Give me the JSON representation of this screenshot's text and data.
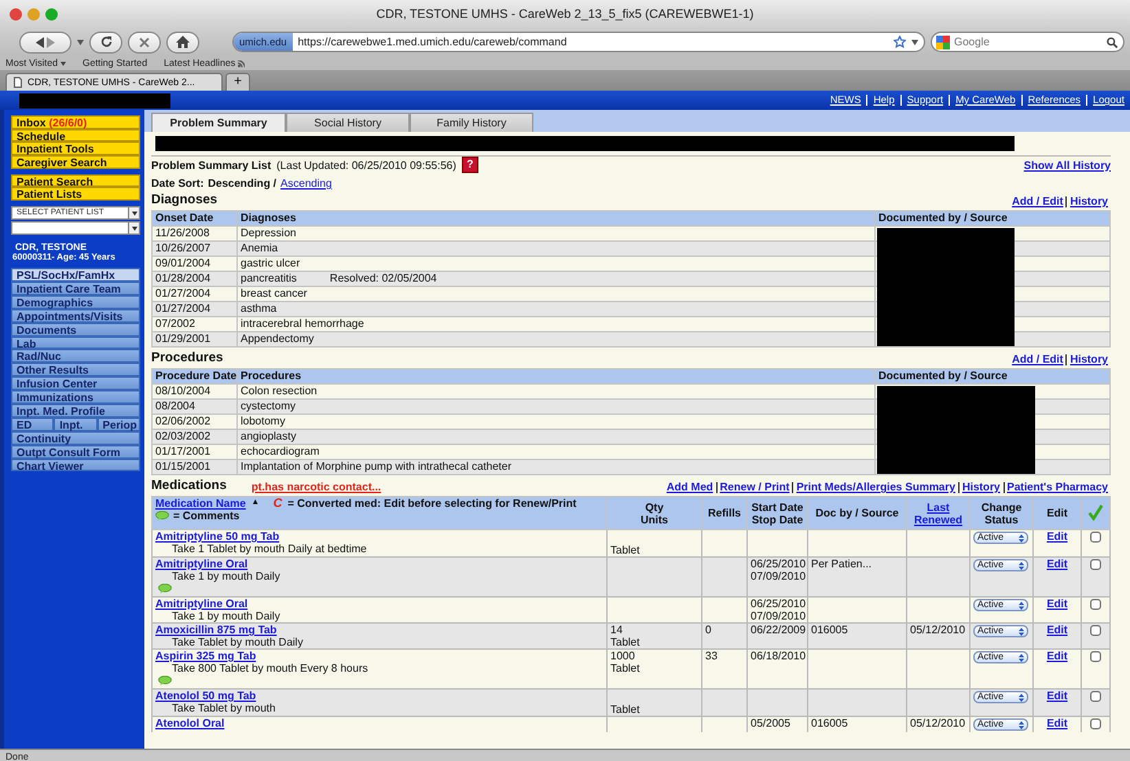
{
  "browser": {
    "title": "CDR, TESTONE UMHS - CareWeb 2_13_5_fix5 (CAREWEBWE1-1)",
    "site_badge": "umich.edu",
    "url": "https://carewebwe1.med.umich.edu/careweb/command",
    "search": {
      "placeholder": "Google"
    },
    "bookmarks": [
      {
        "label": "Most Visited",
        "kind": "menu"
      },
      {
        "label": "Getting Started",
        "kind": "link"
      },
      {
        "label": "Latest Headlines",
        "kind": "feed"
      }
    ],
    "tabs": [
      {
        "label": "CDR, TESTONE UMHS - CareWeb 2...",
        "selected": true
      }
    ],
    "new_tab": "+"
  },
  "top_links": [
    "NEWS",
    "Help",
    "Support",
    "My CareWeb",
    "References",
    "Logout"
  ],
  "sidebar": {
    "primary": [
      {
        "label": "Inbox",
        "count": "(26/6/0)"
      },
      {
        "label": "Schedule"
      },
      {
        "label": "Inpatient Tools"
      },
      {
        "label": "Caregiver Search"
      }
    ],
    "patient_tools": [
      "Patient Search",
      "Patient Lists"
    ],
    "patient_list_select": {
      "value": "SELECT PATIENT LIST"
    },
    "patient": {
      "name": "CDR, TESTONE",
      "info": "60000311- Age: 45 Years"
    },
    "chart_menu": [
      {
        "kind": "item",
        "label": "PSL/SocHx/FamHx",
        "selected": true
      },
      {
        "kind": "item",
        "label": "Inpatient Care Team",
        "selected": false
      },
      {
        "kind": "item",
        "label": "Demographics",
        "selected": false
      },
      {
        "kind": "item",
        "label": "Appointments/Visits",
        "selected": false
      },
      {
        "kind": "item",
        "label": "Documents",
        "selected": false
      },
      {
        "kind": "item",
        "label": "Lab",
        "selected": false
      },
      {
        "kind": "item",
        "label": "Rad/Nuc",
        "selected": false
      },
      {
        "kind": "item",
        "label": "Other Results",
        "selected": false
      },
      {
        "kind": "item",
        "label": "Infusion Center",
        "selected": false
      },
      {
        "kind": "item",
        "label": "Immunizations",
        "selected": false
      },
      {
        "kind": "item",
        "label": "Inpt. Med. Profile",
        "selected": false
      },
      {
        "kind": "split",
        "items": [
          {
            "label": "ED",
            "selected": false
          },
          {
            "label": "Inpt.",
            "selected": false
          },
          {
            "label": "Periop",
            "selected": false
          }
        ]
      },
      {
        "kind": "item",
        "label": "Continuity",
        "selected": false
      },
      {
        "kind": "item",
        "label": "Outpt Consult Form",
        "selected": false
      },
      {
        "kind": "item",
        "label": "Chart Viewer",
        "selected": false
      }
    ]
  },
  "tabs": [
    {
      "label": "Problem Summary",
      "selected": true
    },
    {
      "label": "Social History",
      "selected": false
    },
    {
      "label": "Family History",
      "selected": false
    }
  ],
  "summary": {
    "title": "Problem Summary List",
    "updated": "(Last Updated: 06/25/2010 09:55:56)",
    "help": "?",
    "show_all": "Show All History"
  },
  "date_sort": {
    "label": "Date Sort:",
    "current": "Descending /",
    "link": "Ascending"
  },
  "diagnoses": {
    "title": "Diagnoses",
    "links": [
      "Add / Edit",
      "History"
    ],
    "columns": [
      "Onset Date",
      "Diagnoses",
      "Documented by / Source"
    ],
    "rows": [
      {
        "date": "11/26/2008",
        "name": "Depression"
      },
      {
        "date": "10/26/2007",
        "name": "Anemia"
      },
      {
        "date": "09/01/2004",
        "name": "gastric ulcer"
      },
      {
        "date": "01/28/2004",
        "name": "pancreatitis",
        "note": "Resolved: 02/05/2004"
      },
      {
        "date": "01/27/2004",
        "name": "breast cancer"
      },
      {
        "date": "01/27/2004",
        "name": "asthma"
      },
      {
        "date": "07/2002",
        "name": "intracerebral hemorrhage"
      },
      {
        "date": "01/29/2001",
        "name": "Appendectomy"
      }
    ]
  },
  "procedures": {
    "title": "Procedures",
    "links": [
      "Add / Edit",
      "History"
    ],
    "columns": [
      "Procedure Date",
      "Procedures",
      "Documented by / Source"
    ],
    "rows": [
      {
        "date": "08/10/2004",
        "name": "Colon resection"
      },
      {
        "date": "08/2004",
        "name": "cystectomy"
      },
      {
        "date": "02/06/2002",
        "name": "lobotomy"
      },
      {
        "date": "02/03/2002",
        "name": "angioplasty"
      },
      {
        "date": "01/17/2001",
        "name": "echocardiogram"
      },
      {
        "date": "01/15/2001",
        "name": "Implantation of Morphine pump with intrathecal catheter"
      }
    ]
  },
  "medications": {
    "title": "Medications",
    "alert": "pt.has narcotic contact...",
    "links": [
      "Add Med",
      "Renew / Print",
      "Print Meds/Allergies Summary",
      "History",
      "Patient's Pharmacy"
    ],
    "legend": {
      "sort_link": "Medication Name",
      "sort_arrow": "▲",
      "converted_mark": "C",
      "converted_text": "= Converted med: Edit before selecting for Renew/Print",
      "comments_text": "= Comments"
    },
    "columns": [
      {
        "kind": "text",
        "lines": [
          "Qty",
          "Units"
        ]
      },
      {
        "kind": "text",
        "lines": [
          "Refills"
        ]
      },
      {
        "kind": "text",
        "lines": [
          "Start Date",
          "Stop Date"
        ]
      },
      {
        "kind": "text",
        "lines": [
          "Doc by / Source"
        ]
      },
      {
        "kind": "link",
        "lines": [
          "Last",
          "Renewed"
        ]
      },
      {
        "kind": "text",
        "lines": [
          "Change",
          "Status"
        ]
      },
      {
        "kind": "text",
        "lines": [
          "Edit"
        ]
      }
    ],
    "rows": [
      {
        "name": "Amitriptyline 50 mg Tab",
        "instructions": "Take 1 Tablet by mouth Daily at bedtime",
        "comment": false,
        "units": "Tablet",
        "status": "Active",
        "edit": "Edit",
        "checked": false
      },
      {
        "name": "Amitriptyline Oral",
        "instructions": "Take 1 by mouth Daily",
        "comment": true,
        "start": "06/25/2010",
        "stop": "07/09/2010",
        "source": "Per Patien...",
        "status": "Active",
        "edit": "Edit",
        "checked": false
      },
      {
        "name": "Amitriptyline Oral",
        "instructions": "Take 1 by mouth Daily",
        "comment": false,
        "start": "06/25/2010",
        "stop": "07/09/2010",
        "status": "Active",
        "edit": "Edit",
        "checked": false
      },
      {
        "name": "Amoxicillin 875 mg Tab",
        "instructions": "Take Tablet by mouth Daily",
        "comment": false,
        "qty": "14",
        "units": "Tablet",
        "refills": "0",
        "start": "06/22/2009",
        "source": "016005",
        "renewed": "05/12/2010",
        "status": "Active",
        "edit": "Edit",
        "checked": false
      },
      {
        "name": "Aspirin 325 mg Tab",
        "instructions": "Take 800 Tablet by mouth Every 8 hours",
        "comment": true,
        "qty": "1000",
        "units": "Tablet",
        "refills": "33",
        "start": "06/18/2010",
        "status": "Active",
        "edit": "Edit",
        "checked": false
      },
      {
        "name": "Atenolol 50 mg Tab",
        "instructions": "Take Tablet by mouth",
        "comment": false,
        "units": "Tablet",
        "status": "Active",
        "edit": "Edit",
        "checked": false
      },
      {
        "name": "Atenolol Oral",
        "comment": false,
        "start": "05/2005",
        "source": "016005",
        "renewed": "05/12/2010",
        "status": "Active",
        "edit": "Edit",
        "checked": false
      }
    ]
  },
  "status_bar": "Done"
}
